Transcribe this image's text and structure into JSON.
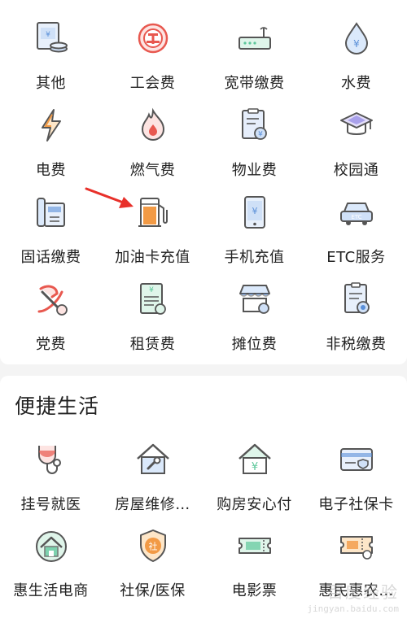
{
  "colors": {
    "accent_orange": "#f29a45",
    "accent_red": "#e8584f",
    "accent_blue": "#5a8fd8",
    "accent_green": "#5cc79a",
    "accent_purple": "#7a6fe0",
    "arrow_red": "#e8302a",
    "line_gray": "#555555"
  },
  "services": [
    {
      "label": "其他",
      "icon": "bill-coin-icon"
    },
    {
      "label": "工会费",
      "icon": "union-badge-icon"
    },
    {
      "label": "宽带缴费",
      "icon": "router-icon"
    },
    {
      "label": "水费",
      "icon": "water-drop-icon"
    },
    {
      "label": "电费",
      "icon": "lightning-icon"
    },
    {
      "label": "燃气费",
      "icon": "gas-flame-icon"
    },
    {
      "label": "物业费",
      "icon": "property-bill-icon"
    },
    {
      "label": "校园通",
      "icon": "graduation-cap-icon"
    },
    {
      "label": "固话缴费",
      "icon": "landline-phone-icon"
    },
    {
      "label": "加油卡充值",
      "icon": "fuel-pump-icon"
    },
    {
      "label": "手机充值",
      "icon": "mobile-topup-icon"
    },
    {
      "label": "ETC服务",
      "icon": "etc-car-icon",
      "icon_text": "ETC"
    },
    {
      "label": "党费",
      "icon": "party-emblem-icon"
    },
    {
      "label": "租赁费",
      "icon": "rent-receipt-icon"
    },
    {
      "label": "摊位费",
      "icon": "market-stall-icon"
    },
    {
      "label": "非税缴费",
      "icon": "tax-document-icon"
    }
  ],
  "section": {
    "title": "便捷生活"
  },
  "life": [
    {
      "label": "挂号就医",
      "icon": "stethoscope-icon"
    },
    {
      "label": "房屋维修…",
      "icon": "house-repair-icon"
    },
    {
      "label": "购房安心付",
      "icon": "house-yuan-icon"
    },
    {
      "label": "电子社保卡",
      "icon": "social-security-card-icon"
    },
    {
      "label": "惠生活电商",
      "icon": "eco-house-icon"
    },
    {
      "label": "社保/医保",
      "icon": "shield-badge-icon",
      "icon_text": "社"
    },
    {
      "label": "电影票",
      "icon": "movie-ticket-icon"
    },
    {
      "label": "惠民惠农…",
      "icon": "coupon-icon"
    }
  ],
  "watermark": {
    "main": "百度经验",
    "sub": "jingyan.baidu.com"
  }
}
